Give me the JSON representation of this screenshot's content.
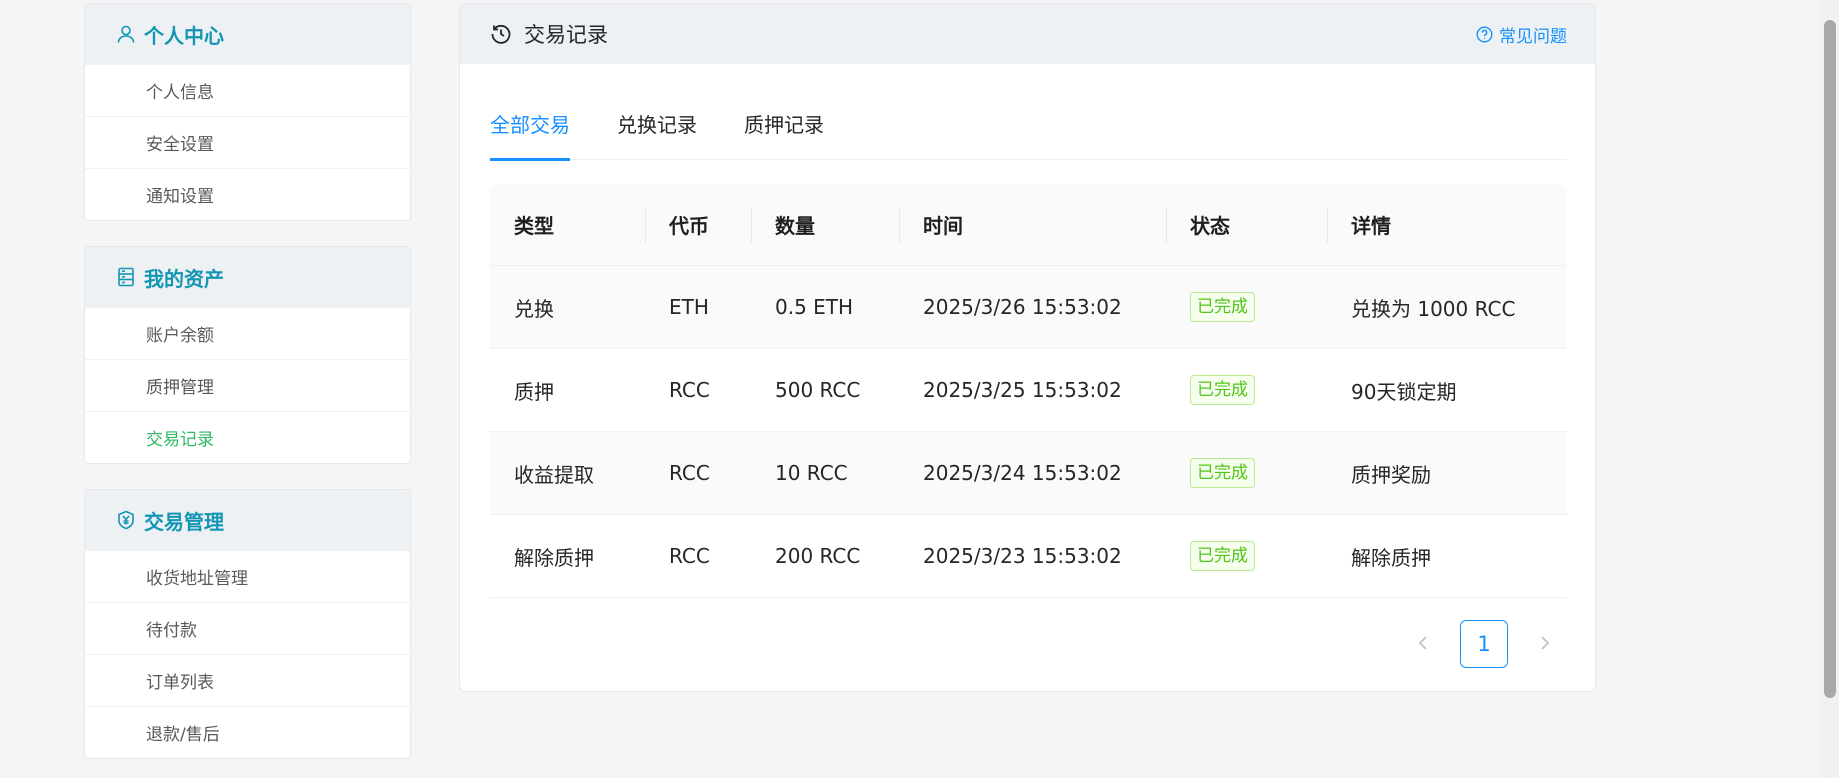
{
  "sidebar": {
    "groups": [
      {
        "title": "个人中心",
        "icon": "user-icon",
        "items": [
          {
            "label": "个人信息"
          },
          {
            "label": "安全设置"
          },
          {
            "label": "通知设置"
          }
        ]
      },
      {
        "title": "我的资产",
        "icon": "wallet-icon",
        "items": [
          {
            "label": "账户余额"
          },
          {
            "label": "质押管理"
          },
          {
            "label": "交易记录",
            "active": true
          }
        ]
      },
      {
        "title": "交易管理",
        "icon": "yen-shield-icon",
        "items": [
          {
            "label": "收货地址管理"
          },
          {
            "label": "待付款"
          },
          {
            "label": "订单列表"
          },
          {
            "label": "退款/售后"
          }
        ]
      }
    ]
  },
  "main": {
    "title": "交易记录",
    "title_icon": "history-icon",
    "faq_label": "常见问题",
    "faq_icon": "question-circle-icon",
    "tabs": [
      {
        "label": "全部交易",
        "active": true
      },
      {
        "label": "兑换记录"
      },
      {
        "label": "质押记录"
      }
    ],
    "table": {
      "columns": [
        "类型",
        "代币",
        "数量",
        "时间",
        "状态",
        "详情"
      ],
      "rows": [
        {
          "type": "兑换",
          "token": "ETH",
          "amount": "0.5 ETH",
          "time": "2025/3/26 15:53:02",
          "status": "已完成",
          "detail": "兑换为 1000 RCC"
        },
        {
          "type": "质押",
          "token": "RCC",
          "amount": "500 RCC",
          "time": "2025/3/25 15:53:02",
          "status": "已完成",
          "detail": "90天锁定期"
        },
        {
          "type": "收益提取",
          "token": "RCC",
          "amount": "10 RCC",
          "time": "2025/3/24 15:53:02",
          "status": "已完成",
          "detail": "质押奖励"
        },
        {
          "type": "解除质押",
          "token": "RCC",
          "amount": "200 RCC",
          "time": "2025/3/23 15:53:02",
          "status": "已完成",
          "detail": "解除质押"
        }
      ]
    },
    "pagination": {
      "current_page": "1",
      "prev_icon": "chevron-left-icon",
      "next_icon": "chevron-right-icon"
    }
  },
  "colors": {
    "accent": "#1890ff",
    "sidebar_heading": "#1296b3",
    "active_menu": "#2fba62",
    "status_success": "#52c41a"
  }
}
